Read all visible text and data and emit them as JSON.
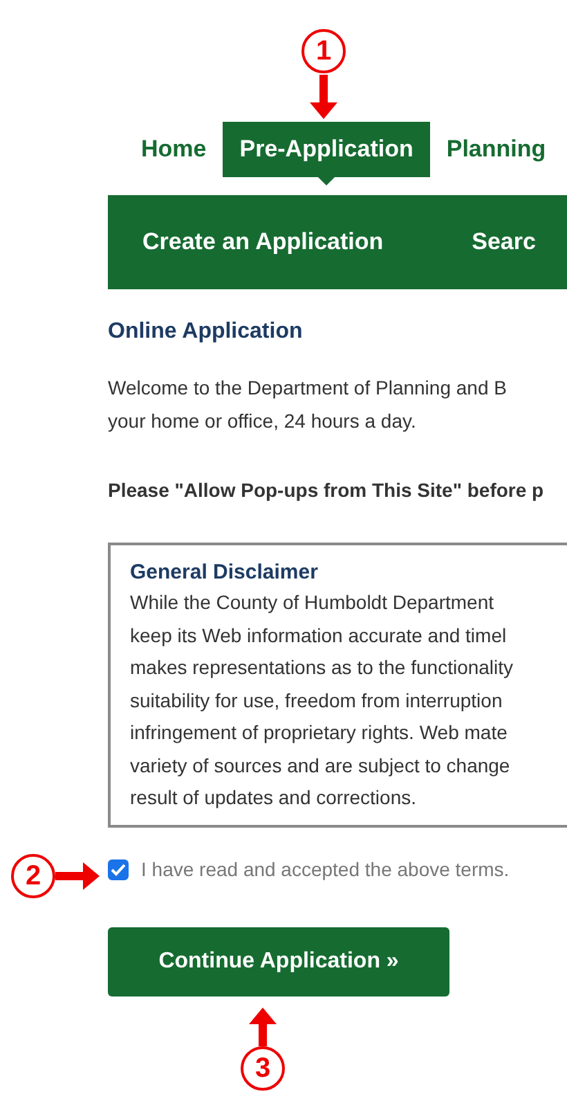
{
  "annotations": [
    {
      "label": "1"
    },
    {
      "label": "2"
    },
    {
      "label": "3"
    }
  ],
  "nav": {
    "tabs": [
      {
        "label": "Home",
        "selected": false
      },
      {
        "label": "Pre-Application",
        "selected": true
      },
      {
        "label": "Planning",
        "selected": false
      }
    ]
  },
  "subnav": {
    "items": [
      "Create an Application",
      "Searc"
    ]
  },
  "heading": "Online Application",
  "intro_lines": [
    "Welcome to the Department of Planning and B",
    "your home or office, 24 hours a day."
  ],
  "popup_note": "Please \"Allow Pop-ups from This Site\" before p",
  "disclaimer": {
    "title": "General Disclaimer",
    "lines": [
      "While the County of Humboldt Department",
      "keep its Web information accurate and timel",
      "makes representations as to the functionality",
      "suitability for use, freedom from interruption",
      "infringement of proprietary rights. Web mate",
      "variety of sources and are subject to change",
      "result of updates and corrections."
    ]
  },
  "terms": {
    "label": "I have read and accepted the above terms.",
    "checked": true
  },
  "continue_button": "Continue Application »"
}
